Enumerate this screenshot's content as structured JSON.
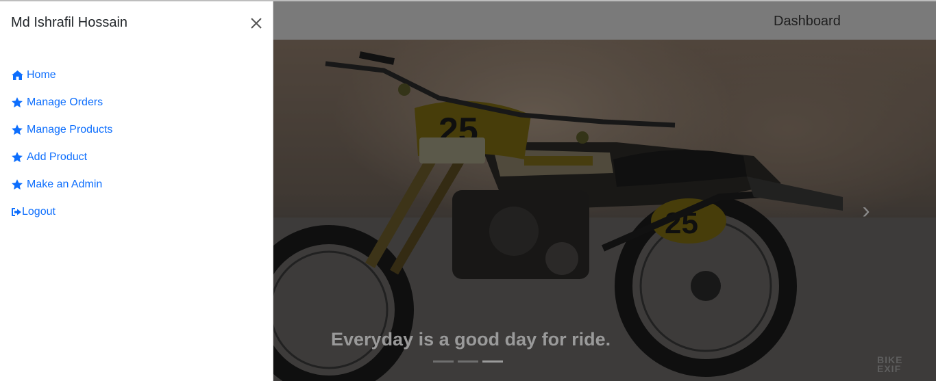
{
  "sidebar": {
    "title": "Md Ishrafil Hossain",
    "items": [
      {
        "label": "Home",
        "icon": "home-icon"
      },
      {
        "label": "Manage Orders",
        "icon": "star-icon"
      },
      {
        "label": "Manage Products",
        "icon": "star-icon"
      },
      {
        "label": "Add Product",
        "icon": "star-icon"
      },
      {
        "label": "Make an Admin",
        "icon": "star-icon"
      },
      {
        "label": "Logout",
        "icon": "sign-out-icon"
      }
    ]
  },
  "navbar": {
    "link": "Dashboard"
  },
  "carousel": {
    "caption": "Everyday is a good day for ride.",
    "slide_count": 3,
    "active_slide": 3,
    "plate_number": "25",
    "watermark": "BIKE EXIF"
  },
  "colors": {
    "link": "#0d6efd",
    "sidebar_bg": "#ffffff",
    "backdrop": "#000000"
  }
}
